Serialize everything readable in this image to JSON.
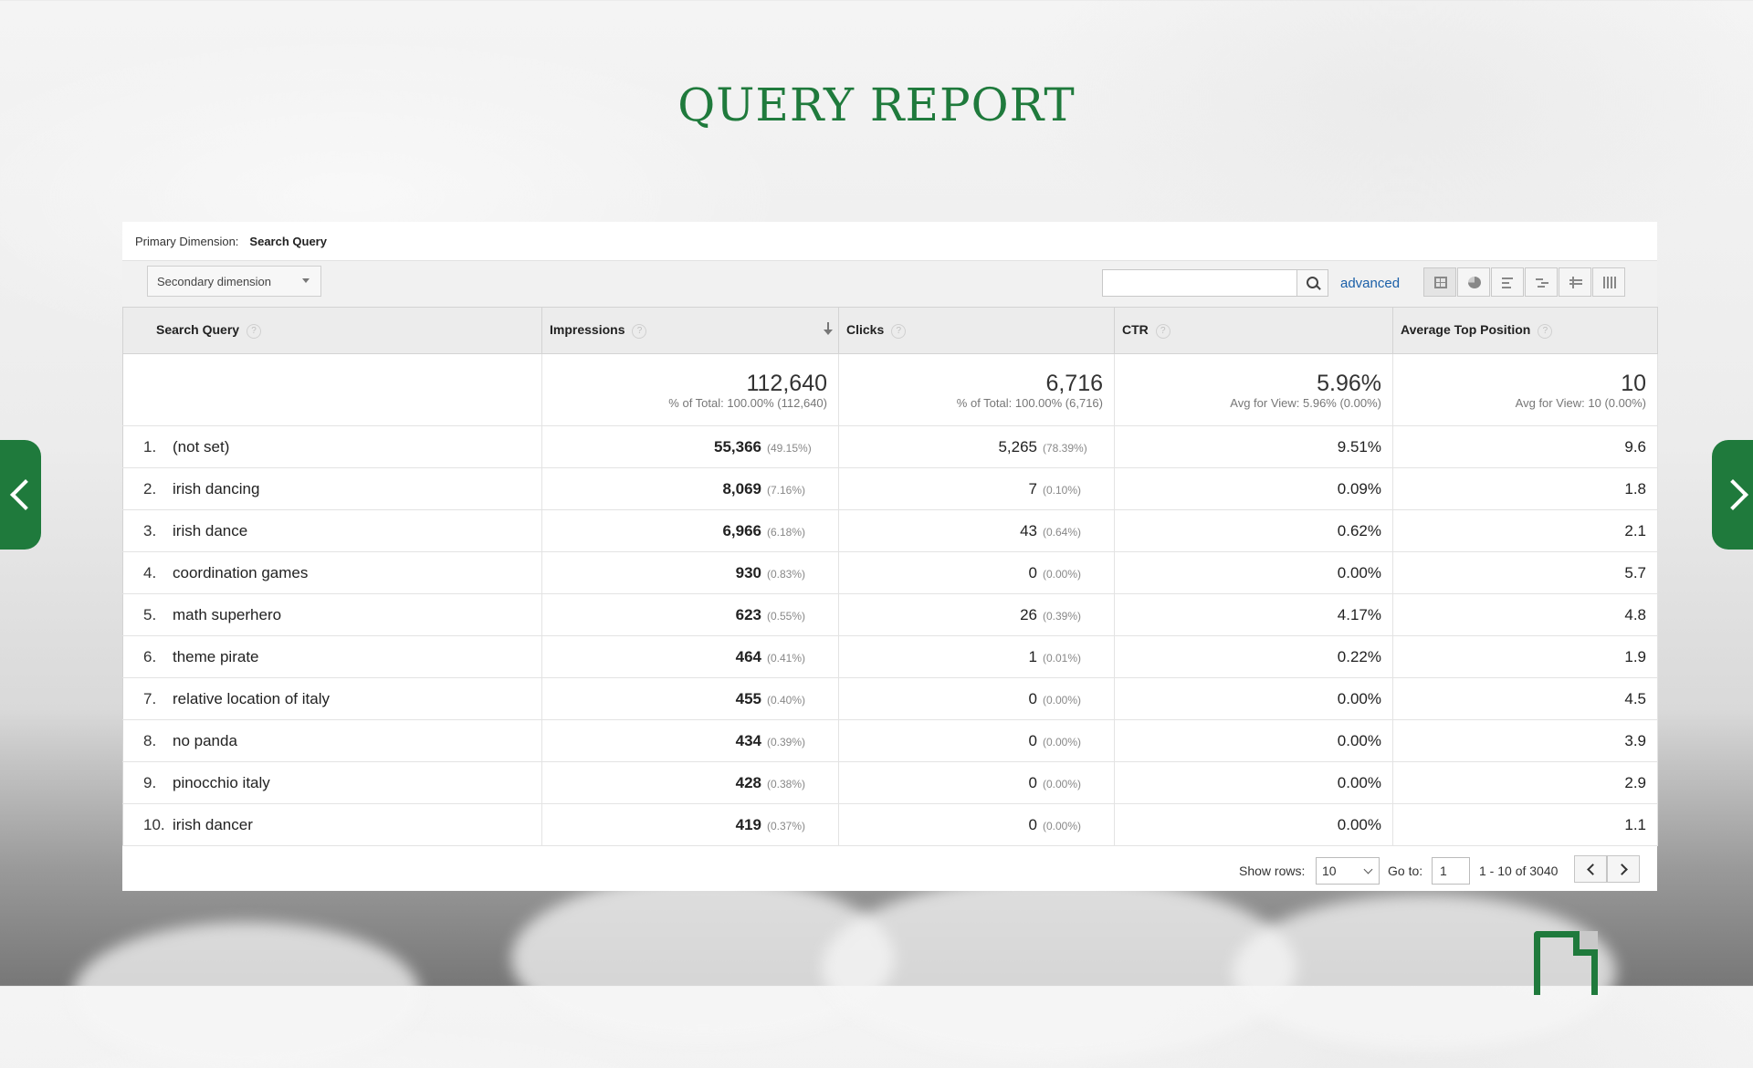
{
  "page": {
    "title": "QUERY REPORT"
  },
  "report": {
    "primary_dimension_label": "Primary Dimension:",
    "primary_dimension_value": "Search Query",
    "secondary_dimension_label": "Secondary dimension",
    "search_placeholder": "",
    "advanced_label": "advanced",
    "columns": [
      "Search Query",
      "Impressions",
      "Clicks",
      "CTR",
      "Average Top Position"
    ],
    "help_glyph": "?",
    "totals": {
      "impressions": {
        "value": "112,640",
        "sub": "% of Total: 100.00% (112,640)"
      },
      "clicks": {
        "value": "6,716",
        "sub": "% of Total: 100.00% (6,716)"
      },
      "ctr": {
        "value": "5.96%",
        "sub": "Avg for View: 5.96% (0.00%)"
      },
      "avg_position": {
        "value": "10",
        "sub": "Avg for View: 10 (0.00%)"
      }
    },
    "rows": [
      {
        "idx": "1.",
        "query": "(not set)",
        "impressions": "55,366",
        "imp_pct": "(49.15%)",
        "clicks": "5,265",
        "clk_pct": "(78.39%)",
        "ctr": "9.51%",
        "pos": "9.6"
      },
      {
        "idx": "2.",
        "query": "irish dancing",
        "impressions": "8,069",
        "imp_pct": "(7.16%)",
        "clicks": "7",
        "clk_pct": "(0.10%)",
        "ctr": "0.09%",
        "pos": "1.8"
      },
      {
        "idx": "3.",
        "query": "irish dance",
        "impressions": "6,966",
        "imp_pct": "(6.18%)",
        "clicks": "43",
        "clk_pct": "(0.64%)",
        "ctr": "0.62%",
        "pos": "2.1"
      },
      {
        "idx": "4.",
        "query": "coordination games",
        "impressions": "930",
        "imp_pct": "(0.83%)",
        "clicks": "0",
        "clk_pct": "(0.00%)",
        "ctr": "0.00%",
        "pos": "5.7"
      },
      {
        "idx": "5.",
        "query": "math superhero",
        "impressions": "623",
        "imp_pct": "(0.55%)",
        "clicks": "26",
        "clk_pct": "(0.39%)",
        "ctr": "4.17%",
        "pos": "4.8"
      },
      {
        "idx": "6.",
        "query": "theme pirate",
        "impressions": "464",
        "imp_pct": "(0.41%)",
        "clicks": "1",
        "clk_pct": "(0.01%)",
        "ctr": "0.22%",
        "pos": "1.9"
      },
      {
        "idx": "7.",
        "query": "relative location of italy",
        "impressions": "455",
        "imp_pct": "(0.40%)",
        "clicks": "0",
        "clk_pct": "(0.00%)",
        "ctr": "0.00%",
        "pos": "4.5"
      },
      {
        "idx": "8.",
        "query": "no panda",
        "impressions": "434",
        "imp_pct": "(0.39%)",
        "clicks": "0",
        "clk_pct": "(0.00%)",
        "ctr": "0.00%",
        "pos": "3.9"
      },
      {
        "idx": "9.",
        "query": "pinocchio italy",
        "impressions": "428",
        "imp_pct": "(0.38%)",
        "clicks": "0",
        "clk_pct": "(0.00%)",
        "ctr": "0.00%",
        "pos": "2.9"
      },
      {
        "idx": "10.",
        "query": "irish dancer",
        "impressions": "419",
        "imp_pct": "(0.37%)",
        "clicks": "0",
        "clk_pct": "(0.00%)",
        "ctr": "0.00%",
        "pos": "1.1"
      }
    ],
    "pager": {
      "show_rows_label": "Show rows:",
      "show_rows_value": "10",
      "goto_label": "Go to:",
      "goto_value": "1",
      "range_text": "1 - 10 of 3040"
    }
  },
  "view_icons": [
    "table-view-icon",
    "pie-view-icon",
    "performance-view-icon",
    "comparison-view-icon",
    "term-cloud-view-icon",
    "pivot-view-icon"
  ],
  "colors": {
    "accent": "#1f7a3c",
    "link": "#1a5fa8"
  }
}
